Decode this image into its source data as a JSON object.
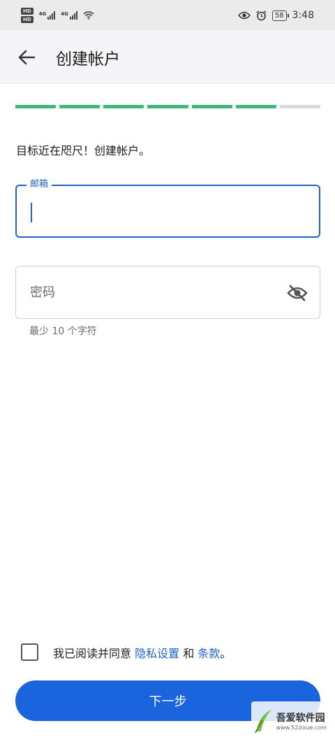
{
  "status_bar": {
    "hd1": "HD",
    "hd2": "HD",
    "net1": "4G",
    "net2": "4G",
    "battery": "58",
    "time": "3:48"
  },
  "app_bar": {
    "title": "创建帐户"
  },
  "progress": {
    "completed_steps": 6,
    "total_steps": 7
  },
  "headline": "目标近在咫尺！创建帐户。",
  "email": {
    "label": "邮箱",
    "value": ""
  },
  "password": {
    "placeholder": "密码",
    "hint": "最少 10 个字符"
  },
  "agreement": {
    "prefix": "我已阅读并同意 ",
    "privacy_link": "隐私设置",
    "and": " 和 ",
    "terms_link": "条款",
    "suffix": "。"
  },
  "next_button": "下一步",
  "watermark": {
    "name": "吾爱软件园",
    "url": "www.52zixue.com"
  },
  "colors": {
    "accent": "#1e63c4",
    "progress_done": "#3cb878",
    "progress_todo": "#dadada",
    "button": "#1a64de"
  }
}
